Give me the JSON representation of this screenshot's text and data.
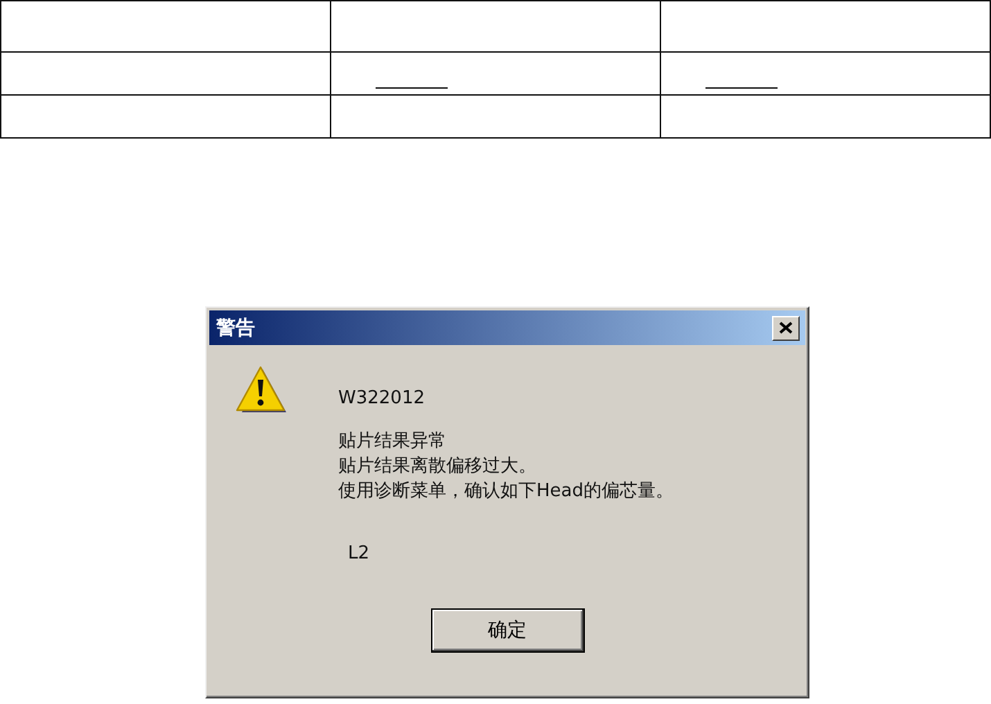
{
  "table": {
    "rows": [
      {
        "cells": [
          {
            "kind": "empty"
          },
          {
            "kind": "empty"
          },
          {
            "kind": "empty"
          }
        ]
      },
      {
        "cells": [
          {
            "kind": "empty"
          },
          {
            "kind": "fill-line"
          },
          {
            "kind": "fill-line"
          }
        ]
      },
      {
        "cells": [
          {
            "kind": "empty"
          },
          {
            "kind": "empty"
          },
          {
            "kind": "empty"
          }
        ]
      }
    ]
  },
  "dialog": {
    "title": "警告",
    "code": "W322012",
    "message": [
      "贴片结果异常",
      "贴片结果离散偏移过大。",
      "使用诊断菜单，确认如下Head的偏芯量。"
    ],
    "detail": "L2",
    "buttons": [
      "确定"
    ]
  }
}
